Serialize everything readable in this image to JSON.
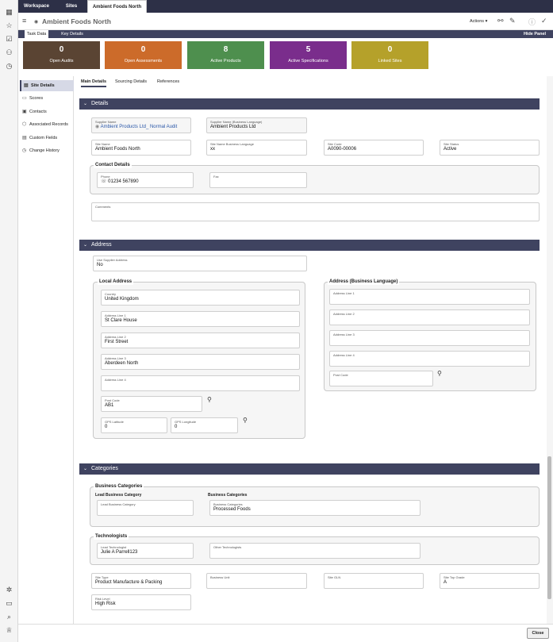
{
  "rail": {
    "icons": [
      "dashboard-icon",
      "star-icon",
      "task-icon",
      "user-icon",
      "history-icon",
      "bug-icon",
      "chat-icon",
      "search-icon",
      "trophy-icon"
    ]
  },
  "tabs": [
    "Workspace",
    "Sites",
    "Ambient Foods North"
  ],
  "header": {
    "title": "Ambient Foods North",
    "actions_label": "Actions"
  },
  "subtabs": {
    "left": [
      "Task Data",
      "Key Details"
    ],
    "hide_panel": "Hide Panel"
  },
  "tiles": [
    {
      "value": "0",
      "label": "Open Audits",
      "color": "#5a4433"
    },
    {
      "value": "0",
      "label": "Open Assessments",
      "color": "#cc6b2a"
    },
    {
      "value": "8",
      "label": "Active Products",
      "color": "#4e8f4e"
    },
    {
      "value": "5",
      "label": "Active Specifications",
      "color": "#7a2d8c"
    },
    {
      "value": "0",
      "label": "Linked Sites",
      "color": "#b5a12a"
    }
  ],
  "nav": [
    "Site Details",
    "Scores",
    "Contacts",
    "Associated Records",
    "Custom Fields",
    "Change History"
  ],
  "content_tabs": [
    "Main Details",
    "Sourcing Details",
    "References"
  ],
  "sections": {
    "details": "Details",
    "address": "Address",
    "categories": "Categories"
  },
  "details": {
    "supplier_name": {
      "label": "Supplier Name",
      "value": "Ambient Products Ltd_ Normal Audit"
    },
    "supplier_name_bl": {
      "label": "Supplier Name (Business Language)",
      "value": "Ambient Products Ltd"
    },
    "site_name": {
      "label": "Site Name",
      "value": "Ambient Foods North"
    },
    "site_name_bl": {
      "label": "Site Name Business Language",
      "value": "xx"
    },
    "site_code": {
      "label": "Site Code",
      "value": "A0090-00006"
    },
    "site_status": {
      "label": "Site Status",
      "value": "Active"
    },
    "contact_title": "Contact Details",
    "phone": {
      "label": "Phone",
      "value": "01234 567890"
    },
    "fax": {
      "label": "Fax",
      "value": ""
    },
    "comments": {
      "label": "Comments",
      "value": ""
    }
  },
  "address": {
    "use_supplier": {
      "label": "Use Supplier Address",
      "value": "No"
    },
    "local_title": "Local Address",
    "country": {
      "label": "Country",
      "value": "United Kingdom"
    },
    "line1": {
      "label": "Address Line 1",
      "value": "St Clare House"
    },
    "line2": {
      "label": "Address Line 2",
      "value": "First Street"
    },
    "line3": {
      "label": "Address Line 3",
      "value": "Aberdeen North"
    },
    "line4": {
      "label": "Address Line 4",
      "value": ""
    },
    "post_code": {
      "label": "Post Code",
      "value": "AB1"
    },
    "lat": {
      "label": "GPS Latitude",
      "value": "0"
    },
    "lng": {
      "label": "GPS Longitude",
      "value": "0"
    },
    "bl_title": "Address (Business Language)",
    "bl_line1": {
      "label": "Address Line 1",
      "value": ""
    },
    "bl_line2": {
      "label": "Address Line 2",
      "value": ""
    },
    "bl_line3": {
      "label": "Address Line 3",
      "value": ""
    },
    "bl_line4": {
      "label": "Address Line 4",
      "value": ""
    },
    "bl_post": {
      "label": "Post Code",
      "value": ""
    }
  },
  "categories": {
    "business_title": "Business Categories",
    "lead_bc_head": "Lead Business Category",
    "bc_head": "Business Categories",
    "lead_bc": {
      "label": "Lead Business Category",
      "value": ""
    },
    "bc": {
      "label": "Business Categories",
      "value": "Processed Foods"
    },
    "tech_title": "Technologists",
    "lead_tech": {
      "label": "Lead Technologist",
      "value": "Julie A Parrell123"
    },
    "other_tech": {
      "label": "Other Technologists",
      "value": ""
    },
    "site_type": {
      "label": "Site Type",
      "value": "Product Manufacture & Packing"
    },
    "business_unit": {
      "label": "Business Unit",
      "value": ""
    },
    "site_gln": {
      "label": "Site GLN",
      "value": ""
    },
    "top_grade": {
      "label": "Site Top Grade",
      "value": "A"
    },
    "risk": {
      "label": "Risk Level",
      "value": "High Risk"
    }
  },
  "footer": {
    "close": "Close"
  }
}
